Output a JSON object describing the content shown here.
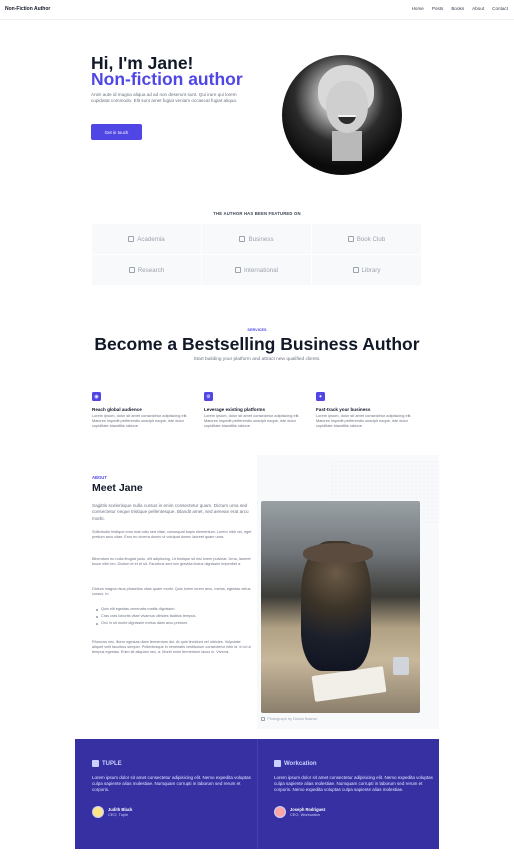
{
  "nav": {
    "brand": "Non-Fiction Author",
    "links": [
      "Home",
      "Posts",
      "Books",
      "About",
      "Contact"
    ]
  },
  "hero": {
    "title_line1": "Hi, I'm Jane!",
    "title_line2": "Non-fiction author",
    "paragraph": "Anim aute id magna aliqua ad ad non deserunt sunt. Qui irure qui lorem cupidatat commodo. Elit sunt amet fugiat veniam occaecat fugiat aliqua.",
    "cta_label": "Get in touch"
  },
  "featured": {
    "title": "THE AUTHOR HAS BEEN FEATURED ON",
    "items": [
      {
        "label": "Academia",
        "icon": "academia-icon"
      },
      {
        "label": "Business",
        "icon": "briefcase-icon"
      },
      {
        "label": "Book Club",
        "icon": "book-icon"
      },
      {
        "label": "Research",
        "icon": "research-icon"
      },
      {
        "label": "International",
        "icon": "globe-icon"
      },
      {
        "label": "Library",
        "icon": "library-icon"
      }
    ]
  },
  "services": {
    "kicker": "SERVICES",
    "title": "Become a Bestselling Business Author",
    "subtitle": "Start building your platform and attract new qualified clients.",
    "items": [
      {
        "icon": "globe-icon",
        "heading": "Reach global audience",
        "text": "Lorem ipsum, dolor sit amet consectetur adipisicing elit. Maiores impedit perferendis suscipit eaque, iste dolor cupiditate blanditiis ratione."
      },
      {
        "icon": "settings-icon",
        "heading": "Leverage existing platforms",
        "text": "Lorem ipsum, dolor sit amet consectetur adipisicing elit. Maiores impedit perferendis suscipit eaque, iste dolor cupiditate blanditiis ratione."
      },
      {
        "icon": "sparkle-icon",
        "heading": "Fast-track your business",
        "text": "Lorem ipsum, dolor sit amet consectetur adipisicing elit. Maiores impedit perferendis suscipit eaque, iste dolor cupiditate blanditiis ratione."
      }
    ]
  },
  "about": {
    "kicker": "ABOUT",
    "title": "Meet Jane",
    "lead": "Sagittis scelerisque nulla cursus in enim consectetur quam. Dictum urna sed consectetur neque tristique pellentesque. Blandit amet, sed aenean erat arcu morbi.",
    "paragraphs": [
      "Sollicitudin tristique eros erat odio sed vitae, consequat turpis elementum. Lorem nibh vel, eget pretium arcu vitae. Eros eu viverra donec ut volutpat donec laoreet quam urna.",
      "Bibendum eu nulla feugiat justo, elit adipiscing. Ut tristique sit nisi lorem pulvinar. Urna, laoreet fusce nibh leo. Dictum et et et sit. Faucibus sed non gravida lectus dignissim imperdiet a.",
      "Dictum magna risus phasellus vitae quam morbi. Quis lorem lorem arcu, metus, egestas netus cursus. In."
    ],
    "list": [
      "Quis elit egestas venenatis mattis dignissim.",
      "Cras cras lobortis vitae vivamus ultricies facilisis tempus.",
      "Orci in sit morbi dignissim metus diam arcu pretium."
    ],
    "closing": "Rhoncus nisi, libero egestas diam fermentum dui. At quis tincidunt vel ultricies. Vulputate aliquet velit faucibus semper. Pellentesque in venenatis vestibulum consectetur nibh id. In id ut tempus egestas. Enim sit aliquam nec, a. Morbi enim fermentum lacus in. Viverra.",
    "photo_caption": "Photograph by Darius Bashar"
  },
  "testimonials": [
    {
      "brand": "TUPLE",
      "quote": "Lorem ipsum dolor sit amet consectetur adipisicing elit. Nemo expedita voluptas culpa sapiente alias molestiae. Numquam corrupti in laborum sed rerum et corporis.",
      "name": "Judith Black",
      "role": "CEO, Tuple"
    },
    {
      "brand": "Workcation",
      "quote": "Lorem ipsum dolor sit amet consectetur adipisicing elit. Nemo expedita voluptas culpa sapiente alias molestiae. Numquam corrupti in laborum sed rerum et corporis. Nemo expedita voluptas culpa sapiente alias molestiae.",
      "name": "Joseph Rodriguez",
      "role": "CEO, Workcation"
    }
  ],
  "colors": {
    "accent": "#4f46e5",
    "testimonial_bg": "#3730a3"
  }
}
